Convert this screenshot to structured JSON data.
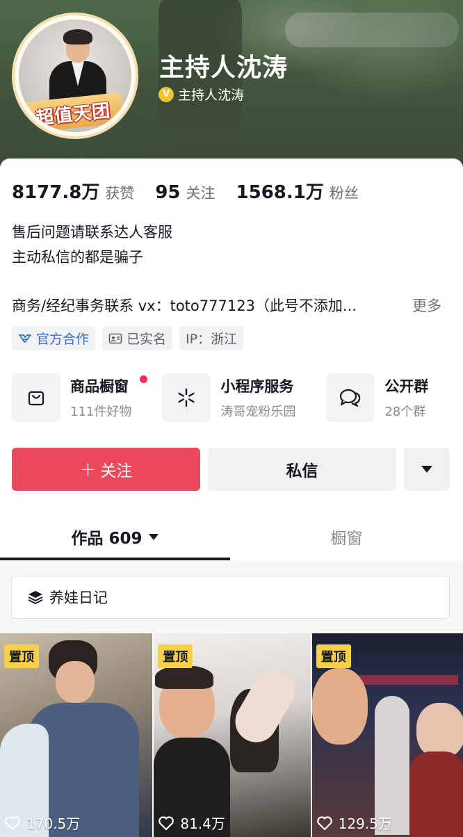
{
  "profile": {
    "nickname": "主持人沈涛",
    "verified_label": "主持人沈涛",
    "avatar_banner": "超值天团"
  },
  "stats": [
    {
      "num": "8177.8万",
      "label": "获赞"
    },
    {
      "num": "95",
      "label": "关注"
    },
    {
      "num": "1568.1万",
      "label": "粉丝"
    }
  ],
  "bio": {
    "lines": [
      "售后问题请联系达人客服",
      "主动私信的都是骗子"
    ],
    "business": "商务/经纪事务联系 vx：toto777123（此号不添加...",
    "more": "更多"
  },
  "tags": [
    {
      "label": "官方合作",
      "icon": "handshake-icon"
    },
    {
      "label": "已实名",
      "icon": "id-card-icon"
    },
    {
      "label": "IP：浙江"
    }
  ],
  "services": [
    {
      "title": "商品橱窗",
      "sub": "111件好物",
      "icon": "shopping-bag-icon"
    },
    {
      "title": "小程序服务",
      "sub": "涛哥宠粉乐园",
      "icon": "mini-program-icon"
    },
    {
      "title": "公开群",
      "sub": "28个群",
      "icon": "chat-bubbles-icon"
    }
  ],
  "actions": {
    "follow": "关注",
    "message": "私信"
  },
  "tabs": {
    "works": "作品 609",
    "shop": "橱窗"
  },
  "collection": {
    "label": "养娃日记"
  },
  "videos": [
    {
      "pin": "置顶",
      "likes": "170.5万"
    },
    {
      "pin": "置顶",
      "likes": "81.4万"
    },
    {
      "pin": "置顶",
      "likes": "129.5万"
    }
  ],
  "colors": {
    "follow_button": "#ea4a5b",
    "pin_badge": "#f7d04a",
    "verify_badge": "#f2c230",
    "official_tag": "#3a6fc0",
    "notification_dot": "#fe2c55"
  }
}
